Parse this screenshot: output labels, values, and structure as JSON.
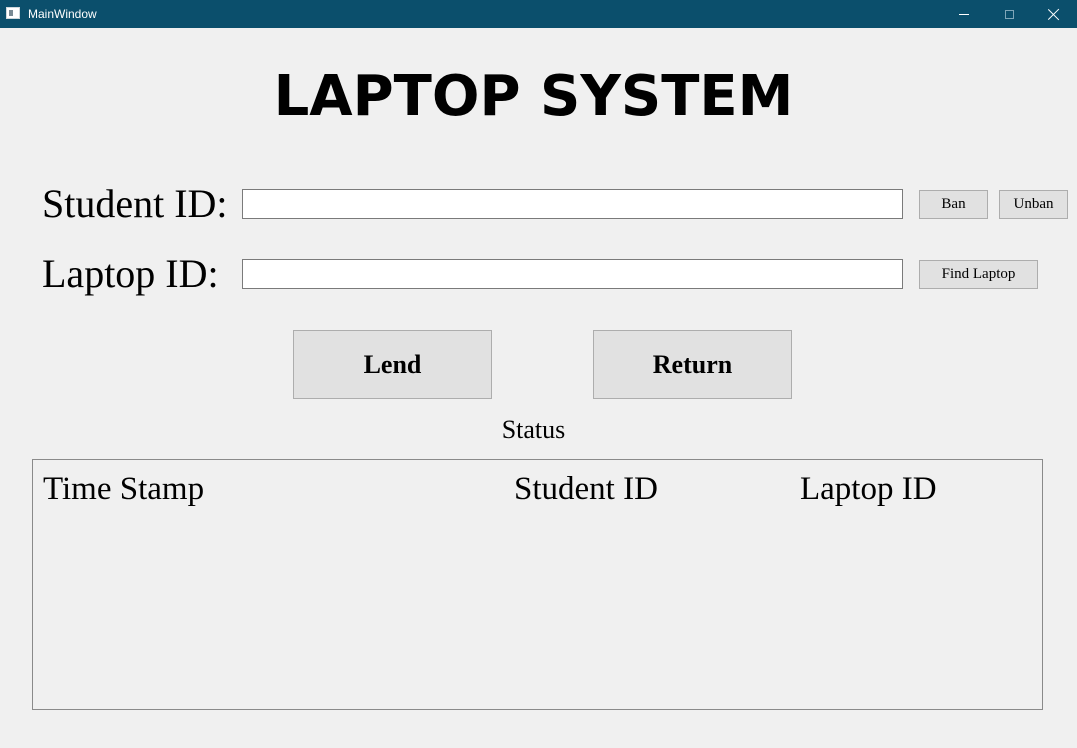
{
  "window": {
    "title": "MainWindow",
    "controls": {
      "minimize": "minimize-icon",
      "maximize": "maximize-icon",
      "close": "close-icon"
    }
  },
  "header": {
    "title": "LAPTOP SYSTEM"
  },
  "form": {
    "student_label": "Student ID:",
    "student_value": "",
    "laptop_label": "Laptop ID:",
    "laptop_value": "",
    "ban_label": "Ban",
    "unban_label": "Unban",
    "find_label": "Find Laptop"
  },
  "actions": {
    "lend_label": "Lend",
    "return_label": "Return"
  },
  "status": {
    "label": "Status",
    "columns": [
      "Time Stamp",
      "Student ID",
      "Laptop ID"
    ],
    "rows": []
  },
  "colors": {
    "titlebar": "#0b4f6c",
    "window_bg": "#f0f0f0",
    "button_bg": "#e1e1e1"
  }
}
